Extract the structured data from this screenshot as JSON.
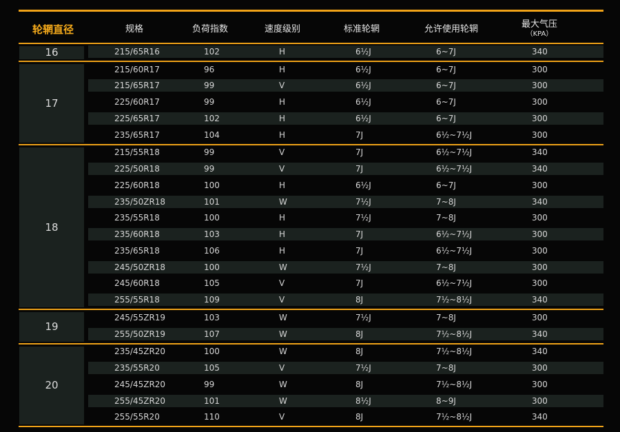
{
  "headers": [
    "轮辋直径",
    "规格",
    "负荷指数",
    "速度级别",
    "标准轮辋",
    "允许使用轮辋",
    "最大气压",
    "（KPA）"
  ],
  "groups": [
    {
      "diameter": "16",
      "rows": [
        [
          "215/65R16",
          "102",
          "H",
          "6½J",
          "6~7J",
          "340"
        ]
      ]
    },
    {
      "diameter": "17",
      "rows": [
        [
          "215/60R17",
          "96",
          "H",
          "6½J",
          "6~7J",
          "300"
        ],
        [
          "215/65R17",
          "99",
          "V",
          "6½J",
          "6~7J",
          "300"
        ],
        [
          "225/60R17",
          "99",
          "H",
          "6½J",
          "6~7J",
          "300"
        ],
        [
          "225/65R17",
          "102",
          "H",
          "6½J",
          "6~7J",
          "300"
        ],
        [
          "235/65R17",
          "104",
          "H",
          "7J",
          "6½~7½J",
          "300"
        ]
      ]
    },
    {
      "diameter": "18",
      "rows": [
        [
          "215/55R18",
          "99",
          "V",
          "7J",
          "6½~7½J",
          "340"
        ],
        [
          "225/50R18",
          "99",
          "V",
          "7J",
          "6½~7½J",
          "340"
        ],
        [
          "225/60R18",
          "100",
          "H",
          "6½J",
          "6~7J",
          "300"
        ],
        [
          "235/50ZR18",
          "101",
          "W",
          "7½J",
          "7~8J",
          "340"
        ],
        [
          "235/55R18",
          "100",
          "H",
          "7½J",
          "7~8J",
          "300"
        ],
        [
          "235/60R18",
          "103",
          "H",
          "7J",
          "6½~7½J",
          "300"
        ],
        [
          "235/65R18",
          "106",
          "H",
          "7J",
          "6½~7½J",
          "300"
        ],
        [
          "245/50ZR18",
          "100",
          "W",
          "7½J",
          "7~8J",
          "300"
        ],
        [
          "245/60R18",
          "105",
          "V",
          "7J",
          "6½~7½J",
          "300"
        ],
        [
          "255/55R18",
          "109",
          "V",
          "8J",
          "7½~8½J",
          "340"
        ]
      ]
    },
    {
      "diameter": "19",
      "rows": [
        [
          "245/55ZR19",
          "103",
          "W",
          "7½J",
          "7~8J",
          "300"
        ],
        [
          "255/50ZR19",
          "107",
          "W",
          "8J",
          "7½~8½J",
          "340"
        ]
      ]
    },
    {
      "diameter": "20",
      "rows": [
        [
          "235/45ZR20",
          "100",
          "W",
          "8J",
          "7½~8½J",
          "340"
        ],
        [
          "235/55R20",
          "105",
          "V",
          "7½J",
          "7~8J",
          "300"
        ],
        [
          "245/45ZR20",
          "99",
          "W",
          "8J",
          "7½~8½J",
          "300"
        ],
        [
          "255/45ZR20",
          "101",
          "W",
          "8½J",
          "8~9J",
          "300"
        ],
        [
          "255/55R20",
          "110",
          "V",
          "8J",
          "7½~8½J",
          "340"
        ]
      ]
    }
  ],
  "colors": {
    "accent": "#f0a318",
    "shade": "#1b221f",
    "background": "#060606"
  }
}
